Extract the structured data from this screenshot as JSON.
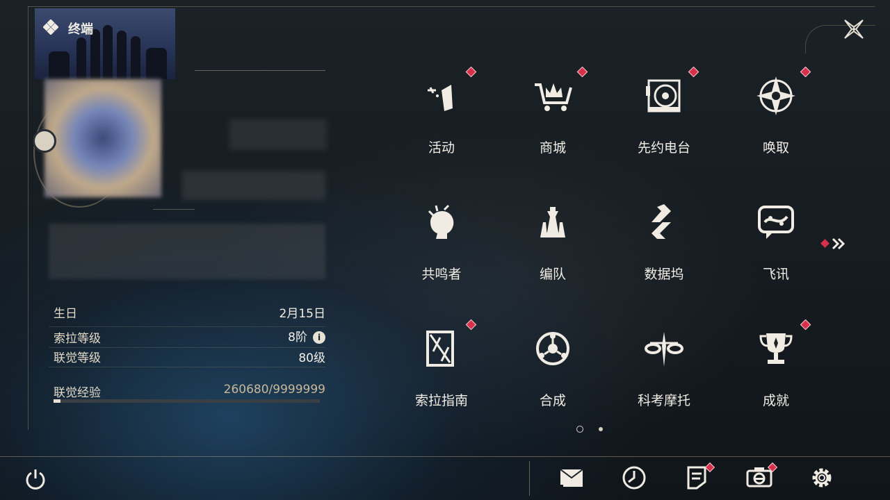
{
  "header": {
    "title": "终端"
  },
  "profile": {
    "birthday_label": "生日",
    "birthday_value": "2月15日",
    "sola_level_label": "索拉等级",
    "sola_level_value": "8阶",
    "union_level_label": "联觉等级",
    "union_level_value": "80级",
    "union_exp_label": "联觉经验",
    "union_exp_value": "260680/9999999",
    "union_exp_progress": 0.026,
    "info_glyph": "i"
  },
  "grid": {
    "tiles": [
      {
        "label": "活动",
        "icon": "activity-icon",
        "badge": true
      },
      {
        "label": "商城",
        "icon": "shop-cart-icon",
        "badge": true
      },
      {
        "label": "先约电台",
        "icon": "radio-icon",
        "badge": true
      },
      {
        "label": "唤取",
        "icon": "compass-star-icon",
        "badge": true
      },
      {
        "label": "共鸣者",
        "icon": "resonator-head-icon",
        "badge": false
      },
      {
        "label": "编队",
        "icon": "chess-team-icon",
        "badge": false
      },
      {
        "label": "数据坞",
        "icon": "data-dock-icon",
        "badge": false
      },
      {
        "label": "飞讯",
        "icon": "chat-bubble-icon",
        "badge": false
      },
      {
        "label": "索拉指南",
        "icon": "guide-book-icon",
        "badge": true
      },
      {
        "label": "合成",
        "icon": "synthesis-icon",
        "badge": false
      },
      {
        "label": "科考摩托",
        "icon": "motorbike-icon",
        "badge": false
      },
      {
        "label": "成就",
        "icon": "trophy-icon",
        "badge": true
      }
    ],
    "next_page_icon": "double-chevron-right-icon",
    "page_count": 2,
    "current_page": 1
  },
  "bottom_bar": {
    "power_icon": "power-icon",
    "buttons": [
      {
        "icon": "mail-icon",
        "badge": false
      },
      {
        "icon": "clock-icon",
        "badge": false
      },
      {
        "icon": "notice-icon",
        "badge": true
      },
      {
        "icon": "camera-icon",
        "badge": true
      },
      {
        "icon": "gear-icon",
        "badge": false
      }
    ]
  },
  "colors": {
    "accent_gold": "#bfa982",
    "badge_red": "#d8304a",
    "text": "#f2eee6"
  }
}
